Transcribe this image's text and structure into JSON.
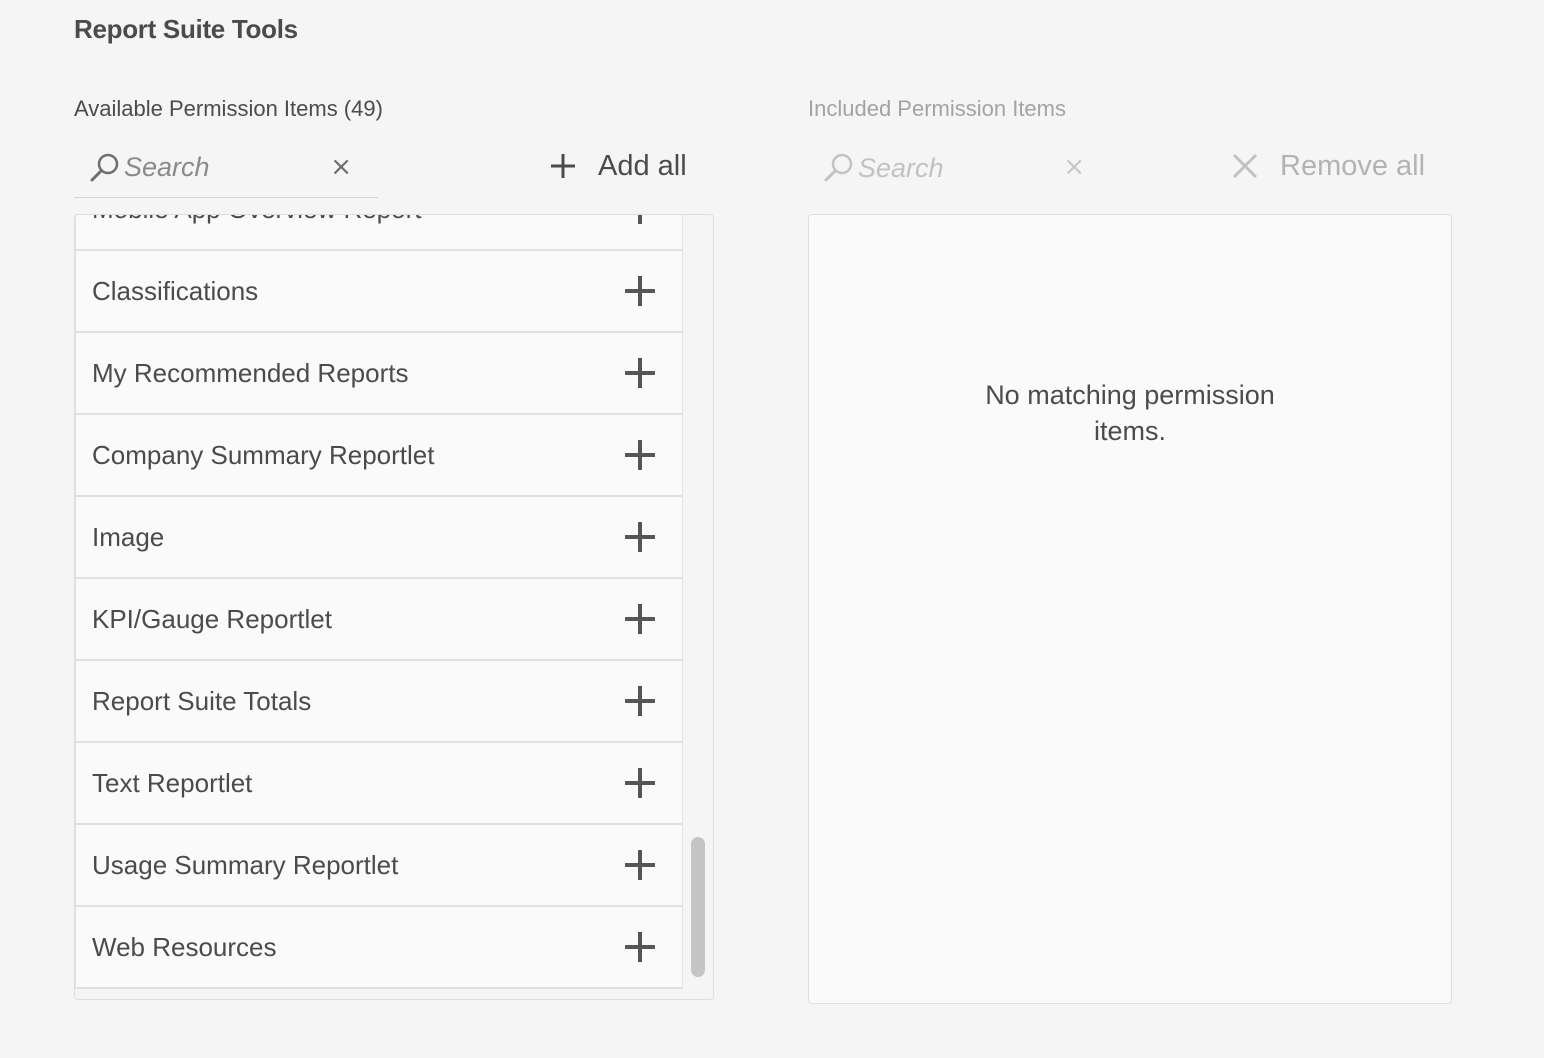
{
  "page": {
    "title": "Report Suite Tools"
  },
  "available": {
    "label": "Available Permission Items (49)",
    "search_placeholder": "Search",
    "clear_symbol": "×",
    "add_all_label": "Add all",
    "items": [
      {
        "label": "Mobile App Overview Report"
      },
      {
        "label": "Classifications"
      },
      {
        "label": "My Recommended Reports"
      },
      {
        "label": "Company Summary Reportlet"
      },
      {
        "label": "Image"
      },
      {
        "label": "KPI/Gauge Reportlet"
      },
      {
        "label": "Report Suite Totals"
      },
      {
        "label": "Text Reportlet"
      },
      {
        "label": "Usage Summary Reportlet"
      },
      {
        "label": "Web Resources"
      }
    ]
  },
  "included": {
    "label": "Included Permission Items",
    "search_placeholder": "Search",
    "clear_symbol": "×",
    "remove_all_label": "Remove all",
    "empty_message": "No matching permission items."
  },
  "icons": {
    "search": "search-icon",
    "plus": "plus-icon",
    "close": "close-icon"
  },
  "colors": {
    "text": "#4b4b4b",
    "muted": "#b3b3b3",
    "background": "#f5f5f5"
  }
}
